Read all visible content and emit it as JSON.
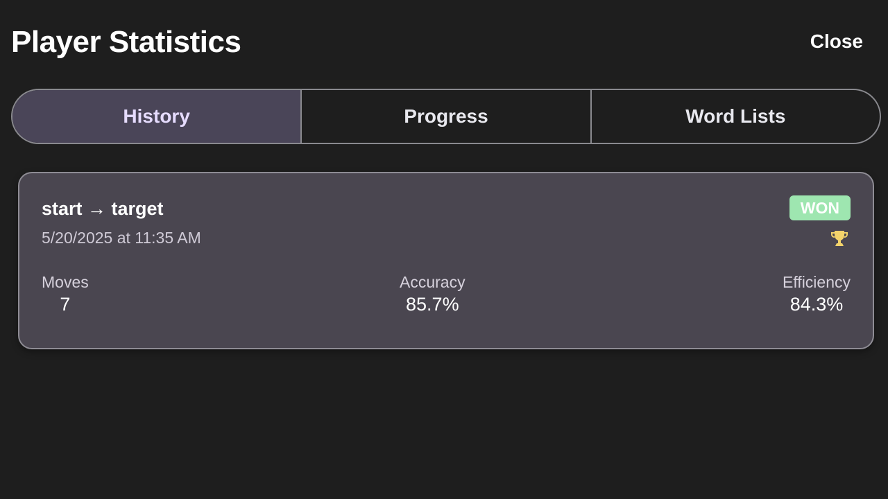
{
  "header": {
    "title": "Player Statistics",
    "close_label": "Close"
  },
  "tabs": [
    {
      "label": "History",
      "active": true
    },
    {
      "label": "Progress",
      "active": false
    },
    {
      "label": "Word Lists",
      "active": false
    }
  ],
  "history": [
    {
      "title": "start → target",
      "date": "5/20/2025 at 11:35 AM",
      "status": "WON",
      "status_color": "#9ee6b0",
      "icon": "trophy-icon",
      "stats": {
        "moves_label": "Moves",
        "moves_value": "7",
        "accuracy_label": "Accuracy",
        "accuracy_value": "85.7%",
        "efficiency_label": "Efficiency",
        "efficiency_value": "84.3%"
      }
    }
  ],
  "colors": {
    "background": "#1e1e1e",
    "active_tab": "#4a4558",
    "card": "#4a4650",
    "trophy": "#f3d36b"
  }
}
